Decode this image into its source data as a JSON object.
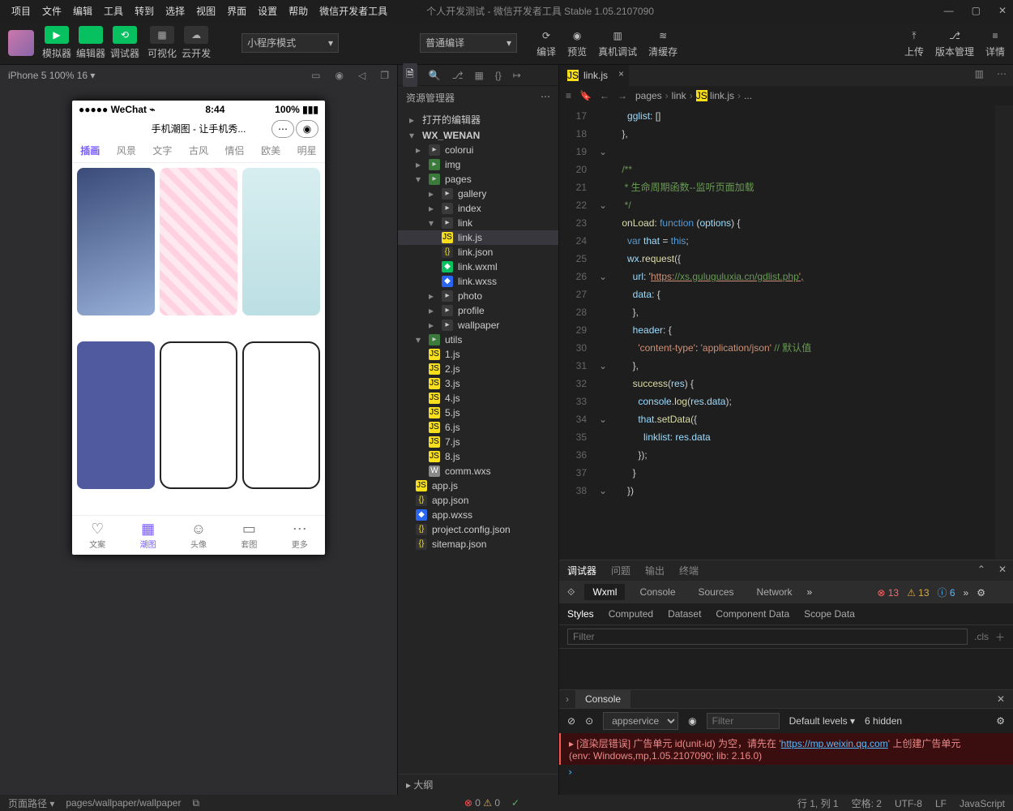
{
  "menubar": {
    "items": [
      "项目",
      "文件",
      "编辑",
      "工具",
      "转到",
      "选择",
      "视图",
      "界面",
      "设置",
      "帮助",
      "微信开发者工具"
    ],
    "title": "个人开发测试 - 微信开发者工具 Stable 1.05.2107090"
  },
  "toolbar": {
    "g1": [
      {
        "lbl": "模拟器",
        "ic": "▶"
      },
      {
        "lbl": "编辑器",
        "ic": "</>"
      },
      {
        "lbl": "调试器",
        "ic": "⟲"
      }
    ],
    "g2": [
      {
        "lbl": "可视化",
        "ic": "▦"
      },
      {
        "lbl": "云开发",
        "ic": "☁"
      }
    ],
    "dd1": "小程序模式",
    "dd2": "普通编译",
    "g3": [
      {
        "lbl": "编译",
        "ic": "⟳"
      },
      {
        "lbl": "预览",
        "ic": "◉"
      },
      {
        "lbl": "真机调试",
        "ic": "▥"
      },
      {
        "lbl": "清缓存",
        "ic": "≋"
      }
    ],
    "g4": [
      {
        "lbl": "上传",
        "ic": "⤒"
      },
      {
        "lbl": "版本管理",
        "ic": "⎇"
      },
      {
        "lbl": "详情",
        "ic": "≡"
      }
    ]
  },
  "sim": {
    "bar": "iPhone 5 100% 16 ▾",
    "icons": [
      "▭",
      "◉",
      "◁",
      "❐"
    ],
    "status": {
      "l": "●●●●● WeChat ⌁",
      "c": "8:44",
      "r": "100% ▮▮▮"
    },
    "title": "手机潮图 - 让手机秀...",
    "tabs": [
      "插画",
      "风景",
      "文字",
      "古风",
      "情侣",
      "欧美",
      "明星"
    ],
    "btabs": [
      {
        "t": "文案",
        "i": "♡"
      },
      {
        "t": "潮图",
        "i": "▦"
      },
      {
        "t": "头像",
        "i": "☺"
      },
      {
        "t": "套图",
        "i": "▭"
      },
      {
        "t": "更多",
        "i": "⋯"
      }
    ]
  },
  "explorer": {
    "title": "资源管理器",
    "s1": "打开的编辑器",
    "root": "WX_WENAN",
    "outline": "大纲",
    "tree": [
      {
        "t": "colorui",
        "k": "folder",
        "lv": 1,
        "c": 1
      },
      {
        "t": "img",
        "k": "folder",
        "lv": 1,
        "c": 1,
        "green": 1
      },
      {
        "t": "pages",
        "k": "folder",
        "lv": 1,
        "c": 1,
        "o": 1,
        "green": 1
      },
      {
        "t": "gallery",
        "k": "folder",
        "lv": 2,
        "c": 1
      },
      {
        "t": "index",
        "k": "folder",
        "lv": 2,
        "c": 1
      },
      {
        "t": "link",
        "k": "folder",
        "lv": 2,
        "c": 1,
        "o": 1
      },
      {
        "t": "link.js",
        "k": "js",
        "lv": 3,
        "sel": 1
      },
      {
        "t": "link.json",
        "k": "json",
        "lv": 3
      },
      {
        "t": "link.wxml",
        "k": "wxml",
        "lv": 3
      },
      {
        "t": "link.wxss",
        "k": "wxss",
        "lv": 3
      },
      {
        "t": "photo",
        "k": "folder",
        "lv": 2,
        "c": 1
      },
      {
        "t": "profile",
        "k": "folder",
        "lv": 2,
        "c": 1
      },
      {
        "t": "wallpaper",
        "k": "folder",
        "lv": 2,
        "c": 1
      },
      {
        "t": "utils",
        "k": "folder",
        "lv": 1,
        "c": 1,
        "o": 1,
        "green": 1
      },
      {
        "t": "1.js",
        "k": "js",
        "lv": 2
      },
      {
        "t": "2.js",
        "k": "js",
        "lv": 2
      },
      {
        "t": "3.js",
        "k": "js",
        "lv": 2
      },
      {
        "t": "4.js",
        "k": "js",
        "lv": 2
      },
      {
        "t": "5.js",
        "k": "js",
        "lv": 2
      },
      {
        "t": "6.js",
        "k": "js",
        "lv": 2
      },
      {
        "t": "7.js",
        "k": "js",
        "lv": 2
      },
      {
        "t": "8.js",
        "k": "js",
        "lv": 2
      },
      {
        "t": "comm.wxs",
        "k": "wxs",
        "lv": 2
      },
      {
        "t": "app.js",
        "k": "js",
        "lv": 1
      },
      {
        "t": "app.json",
        "k": "json",
        "lv": 1
      },
      {
        "t": "app.wxss",
        "k": "wxss",
        "lv": 1
      },
      {
        "t": "project.config.json",
        "k": "json",
        "lv": 1
      },
      {
        "t": "sitemap.json",
        "k": "json",
        "lv": 1
      }
    ]
  },
  "editor": {
    "tab": "link.js",
    "crumb": [
      "pages",
      "link",
      "link.js",
      "..."
    ],
    "lines": [
      "      gglist: []",
      "    },",
      "",
      "    /**",
      "     * 生命周期函数--监听页面加载",
      "     */",
      "    onLoad: function (options) {",
      "      var that = this;",
      "      wx.request({",
      "        url: 'https://xs.guluguluxia.cn/gdlist.php',",
      "        data: {",
      "        },",
      "        header: {",
      "          'content-type': 'application/json' // 默认值",
      "        },",
      "        success(res) {",
      "          console.log(res.data);",
      "          that.setData({",
      "            linklist: res.data",
      "          });",
      "        }",
      "      })"
    ],
    "start": 17
  },
  "debugger": {
    "tabs": [
      "调试器",
      "问题",
      "输出",
      "终端"
    ],
    "dt": [
      "Wxml",
      "Console",
      "Sources",
      "Network"
    ],
    "badges": {
      "err": "13",
      "warn": "13",
      "info": "6"
    },
    "styles": [
      "Styles",
      "Computed",
      "Dataset",
      "Component Data",
      "Scope Data"
    ],
    "filter": "Filter",
    "cls": ".cls"
  },
  "console": {
    "title": "Console",
    "scope": "appservice",
    "filter": "Filter",
    "level": "Default levels ▾",
    "hidden": "6 hidden",
    "msg1": "▸ [渲染层错误] 广告单元 id(unit-id) 为空，请先在 '",
    "msg1b": "' 上创建广告单元",
    "url": "https://mp.weixin.qq.com",
    "msg2": "  (env: Windows,mp,1.05.2107090; lib: 2.16.0)"
  },
  "status": {
    "l1": "页面路径 ▾",
    "l2": "pages/wallpaper/wallpaper",
    "err": "0",
    "warn": "0",
    "r": [
      "行 1, 列 1",
      "空格: 2",
      "UTF-8",
      "LF",
      "JavaScript"
    ]
  }
}
